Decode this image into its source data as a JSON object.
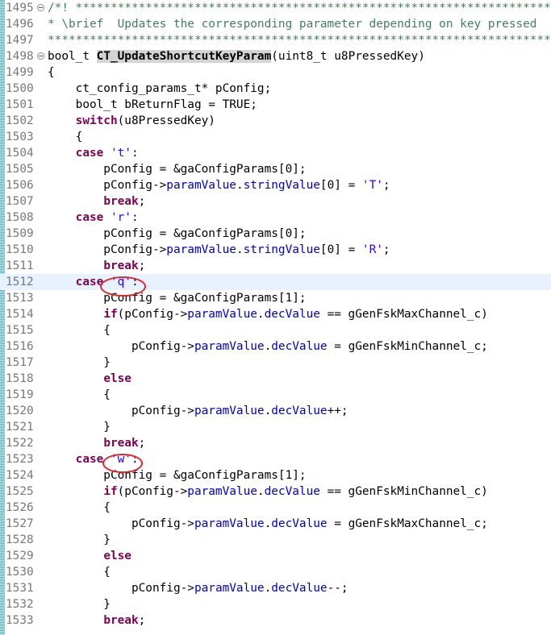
{
  "editor": {
    "lines": [
      {
        "n": "1495",
        "fold": true,
        "tokens": [
          {
            "t": "/*! ******************************************************************************",
            "c": "cm"
          }
        ]
      },
      {
        "n": "1496",
        "tokens": [
          {
            "t": "* \\brief  Updates the corresponding parameter depending on key pressed",
            "c": "cm"
          }
        ]
      },
      {
        "n": "1497",
        "tokens": [
          {
            "t": "********************************************************************************",
            "c": "cm"
          }
        ]
      },
      {
        "n": "1498",
        "fold": true,
        "tokens": [
          {
            "t": "bool_t "
          },
          {
            "t": "CT_UpdateShortcutKeyParam",
            "c": "fn"
          },
          {
            "t": "(uint8_t u8PressedKey)"
          }
        ]
      },
      {
        "n": "1499",
        "tokens": [
          {
            "t": "{"
          }
        ]
      },
      {
        "n": "1500",
        "tokens": [
          {
            "t": "    ct_config_params_t* pConfig;"
          }
        ]
      },
      {
        "n": "1501",
        "tokens": [
          {
            "t": "    bool_t bReturnFlag = TRUE;"
          }
        ]
      },
      {
        "n": "1502",
        "tokens": [
          {
            "t": "    "
          },
          {
            "t": "switch",
            "c": "kw"
          },
          {
            "t": "(u8PressedKey)"
          }
        ]
      },
      {
        "n": "1503",
        "tokens": [
          {
            "t": "    {"
          }
        ]
      },
      {
        "n": "1504",
        "tokens": [
          {
            "t": "    "
          },
          {
            "t": "case",
            "c": "kw"
          },
          {
            "t": " "
          },
          {
            "t": "'t'",
            "c": "str"
          },
          {
            "t": ":"
          }
        ]
      },
      {
        "n": "1505",
        "tokens": [
          {
            "t": "        pConfig = &gaConfigParams[0];"
          }
        ]
      },
      {
        "n": "1506",
        "tokens": [
          {
            "t": "        pConfig->"
          },
          {
            "t": "paramValue",
            "c": "fld"
          },
          {
            "t": "."
          },
          {
            "t": "stringValue",
            "c": "fld"
          },
          {
            "t": "[0] = "
          },
          {
            "t": "'T'",
            "c": "str"
          },
          {
            "t": ";"
          }
        ]
      },
      {
        "n": "1507",
        "tokens": [
          {
            "t": "        "
          },
          {
            "t": "break",
            "c": "kw"
          },
          {
            "t": ";"
          }
        ]
      },
      {
        "n": "1508",
        "tokens": [
          {
            "t": "    "
          },
          {
            "t": "case",
            "c": "kw"
          },
          {
            "t": " "
          },
          {
            "t": "'r'",
            "c": "str"
          },
          {
            "t": ":"
          }
        ]
      },
      {
        "n": "1509",
        "tokens": [
          {
            "t": "        pConfig = &gaConfigParams[0];"
          }
        ]
      },
      {
        "n": "1510",
        "tokens": [
          {
            "t": "        pConfig->"
          },
          {
            "t": "paramValue",
            "c": "fld"
          },
          {
            "t": "."
          },
          {
            "t": "stringValue",
            "c": "fld"
          },
          {
            "t": "[0] = "
          },
          {
            "t": "'R'",
            "c": "str"
          },
          {
            "t": ";"
          }
        ]
      },
      {
        "n": "1511",
        "tokens": [
          {
            "t": "        "
          },
          {
            "t": "break",
            "c": "kw"
          },
          {
            "t": ";"
          }
        ]
      },
      {
        "n": "1512",
        "current": true,
        "tokens": [
          {
            "t": "    "
          },
          {
            "t": "case",
            "c": "kw"
          },
          {
            "t": " "
          },
          {
            "t": "'q'",
            "c": "str"
          },
          {
            "t": ":"
          }
        ]
      },
      {
        "n": "1513",
        "tokens": [
          {
            "t": "        pConfig = &gaConfigParams[1];"
          }
        ]
      },
      {
        "n": "1514",
        "tokens": [
          {
            "t": "        "
          },
          {
            "t": "if",
            "c": "kw"
          },
          {
            "t": "(pConfig->"
          },
          {
            "t": "paramValue",
            "c": "fld"
          },
          {
            "t": "."
          },
          {
            "t": "decValue",
            "c": "fld"
          },
          {
            "t": " == gGenFskMaxChannel_c)"
          }
        ]
      },
      {
        "n": "1515",
        "tokens": [
          {
            "t": "        {"
          }
        ]
      },
      {
        "n": "1516",
        "tokens": [
          {
            "t": "            pConfig->"
          },
          {
            "t": "paramValue",
            "c": "fld"
          },
          {
            "t": "."
          },
          {
            "t": "decValue",
            "c": "fld"
          },
          {
            "t": " = gGenFskMinChannel_c;"
          }
        ]
      },
      {
        "n": "1517",
        "tokens": [
          {
            "t": "        }"
          }
        ]
      },
      {
        "n": "1518",
        "tokens": [
          {
            "t": "        "
          },
          {
            "t": "else",
            "c": "kw"
          }
        ]
      },
      {
        "n": "1519",
        "tokens": [
          {
            "t": "        {"
          }
        ]
      },
      {
        "n": "1520",
        "tokens": [
          {
            "t": "            pConfig->"
          },
          {
            "t": "paramValue",
            "c": "fld"
          },
          {
            "t": "."
          },
          {
            "t": "decValue",
            "c": "fld"
          },
          {
            "t": "++;"
          }
        ]
      },
      {
        "n": "1521",
        "tokens": [
          {
            "t": "        }"
          }
        ]
      },
      {
        "n": "1522",
        "tokens": [
          {
            "t": "        "
          },
          {
            "t": "break",
            "c": "kw"
          },
          {
            "t": ";"
          }
        ]
      },
      {
        "n": "1523",
        "tokens": [
          {
            "t": "    "
          },
          {
            "t": "case",
            "c": "kw"
          },
          {
            "t": " "
          },
          {
            "t": "'w'",
            "c": "str"
          },
          {
            "t": ":"
          }
        ]
      },
      {
        "n": "1524",
        "tokens": [
          {
            "t": "        pConfig = &gaConfigParams[1];"
          }
        ]
      },
      {
        "n": "1525",
        "tokens": [
          {
            "t": "        "
          },
          {
            "t": "if",
            "c": "kw"
          },
          {
            "t": "(pConfig->"
          },
          {
            "t": "paramValue",
            "c": "fld"
          },
          {
            "t": "."
          },
          {
            "t": "decValue",
            "c": "fld"
          },
          {
            "t": " == gGenFskMinChannel_c)"
          }
        ]
      },
      {
        "n": "1526",
        "tokens": [
          {
            "t": "        {"
          }
        ]
      },
      {
        "n": "1527",
        "tokens": [
          {
            "t": "            pConfig->"
          },
          {
            "t": "paramValue",
            "c": "fld"
          },
          {
            "t": "."
          },
          {
            "t": "decValue",
            "c": "fld"
          },
          {
            "t": " = gGenFskMaxChannel_c;"
          }
        ]
      },
      {
        "n": "1528",
        "tokens": [
          {
            "t": "        }"
          }
        ]
      },
      {
        "n": "1529",
        "tokens": [
          {
            "t": "        "
          },
          {
            "t": "else",
            "c": "kw"
          }
        ]
      },
      {
        "n": "1530",
        "tokens": [
          {
            "t": "        {"
          }
        ]
      },
      {
        "n": "1531",
        "tokens": [
          {
            "t": "            pConfig->"
          },
          {
            "t": "paramValue",
            "c": "fld"
          },
          {
            "t": "."
          },
          {
            "t": "decValue",
            "c": "fld"
          },
          {
            "t": "--;"
          }
        ]
      },
      {
        "n": "1532",
        "tokens": [
          {
            "t": "        }"
          }
        ]
      },
      {
        "n": "1533",
        "tokens": [
          {
            "t": "        "
          },
          {
            "t": "break",
            "c": "kw"
          },
          {
            "t": ";"
          }
        ]
      }
    ]
  },
  "colors": {
    "keyword": "#7f0055",
    "comment": "#3f7f5f",
    "string": "#2a00ff",
    "field": "#0000c0",
    "current_line": "#e8f2fe",
    "annotation_circle": "#d8282f"
  },
  "annotations": [
    "red-circle-around-q",
    "red-circle-around-w"
  ]
}
